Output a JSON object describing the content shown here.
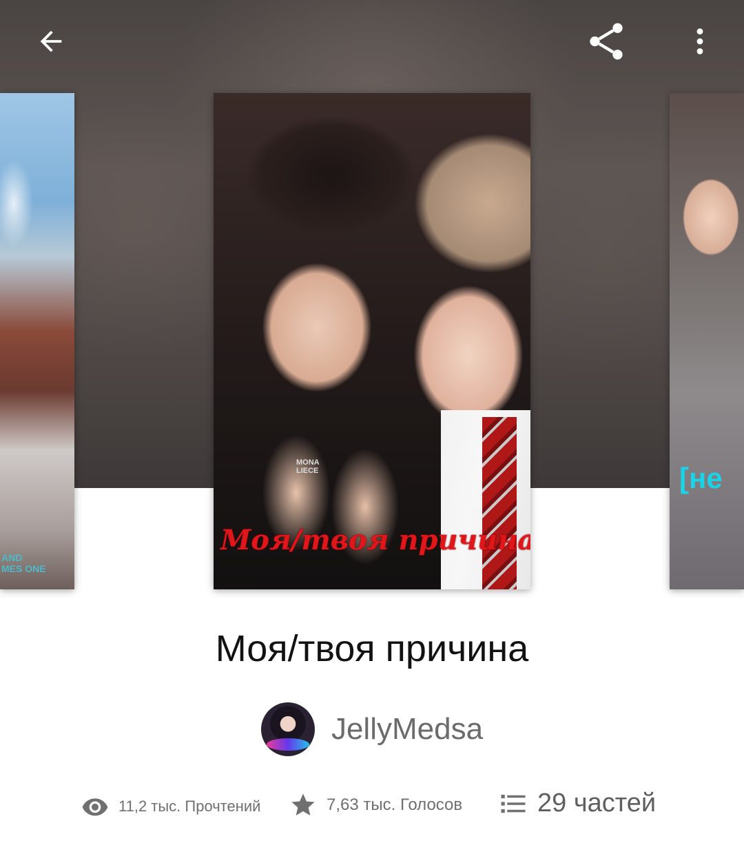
{
  "toolbar": {
    "back_icon": "arrow-left-icon",
    "share_icon": "share-icon",
    "more_icon": "more-vert-icon"
  },
  "covers": {
    "left_partial_text": "AND\nMES ONE",
    "main_title_text": "Моя/твоя причина",
    "main_watermark": "MONA\nLIECE",
    "right_partial_text": "[не"
  },
  "story": {
    "title": "Моя/твоя причина",
    "author": "JellyMedsa"
  },
  "stats": {
    "reads": "11,2 тыс. Прочтений",
    "votes": "7,63 тыс. Голосов",
    "parts": "29 частей"
  },
  "colors": {
    "icon_gray": "#707070",
    "text_dark": "#121212",
    "cover_title_red": "#e0161b",
    "accent_cyan": "#19d4e8"
  }
}
